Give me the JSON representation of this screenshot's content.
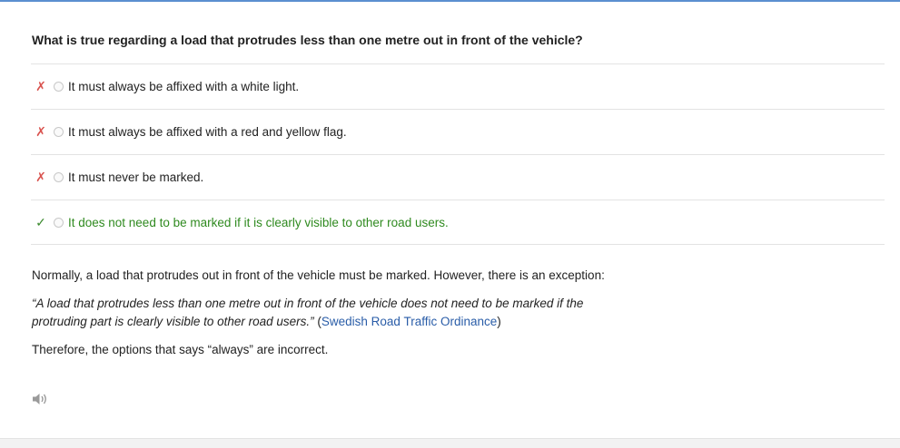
{
  "question": "What is true regarding a load that protrudes less than one metre out in front of the vehicle?",
  "options": [
    {
      "mark": "✗",
      "label": "It must always be affixed with a white light."
    },
    {
      "mark": "✗",
      "label": "It must always be affixed with a red and yellow flag."
    },
    {
      "mark": "✗",
      "label": "It must never be marked."
    },
    {
      "mark": "✓",
      "label": "It does not need to be marked if it is clearly visible to other road users."
    }
  ],
  "explanation": {
    "paragraph1": "Normally, a load that protrudes out in front of the vehicle must be marked. However, there is an exception:",
    "quote": "“A load that protrudes less than one metre out in front of the vehicle does not need to be marked if the protruding part is clearly visible to other road users.”",
    "source_open": " (",
    "source_link": "Swedish Road Traffic Ordinance",
    "source_close": ")",
    "paragraph3": "Therefore, the options that says “always” are incorrect."
  },
  "colors": {
    "accent": "#5b8fd0",
    "wrong": "#d9534f",
    "correct": "#3c8a2e",
    "link": "#2a5da8"
  },
  "icons": {
    "audio": "speaker-icon"
  }
}
